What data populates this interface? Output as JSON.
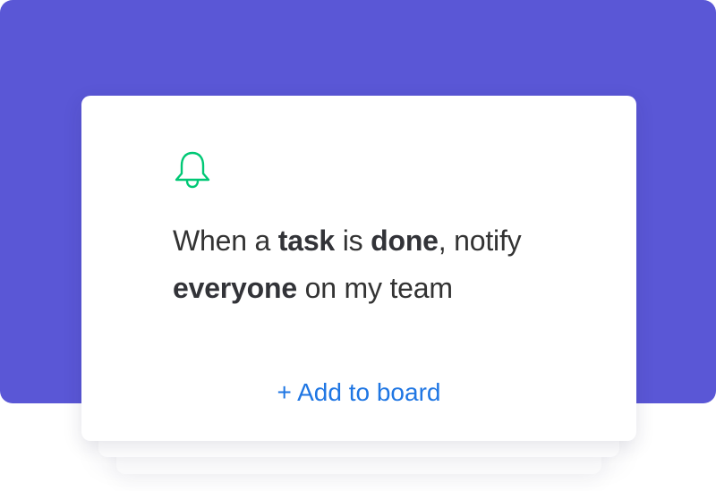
{
  "colors": {
    "background_panel": "#5a57d6",
    "card": "#ffffff",
    "bell_icon": "#00c875",
    "text": "#333333",
    "link": "#1f76e3"
  },
  "card": {
    "icon": "bell-icon",
    "recipe": {
      "part1": "When a ",
      "bold1": "task",
      "part2": " is ",
      "bold2": "done",
      "part3": ", notify ",
      "bold3": "everyone",
      "part4": " on my team"
    },
    "action_label": "+ Add to board"
  }
}
